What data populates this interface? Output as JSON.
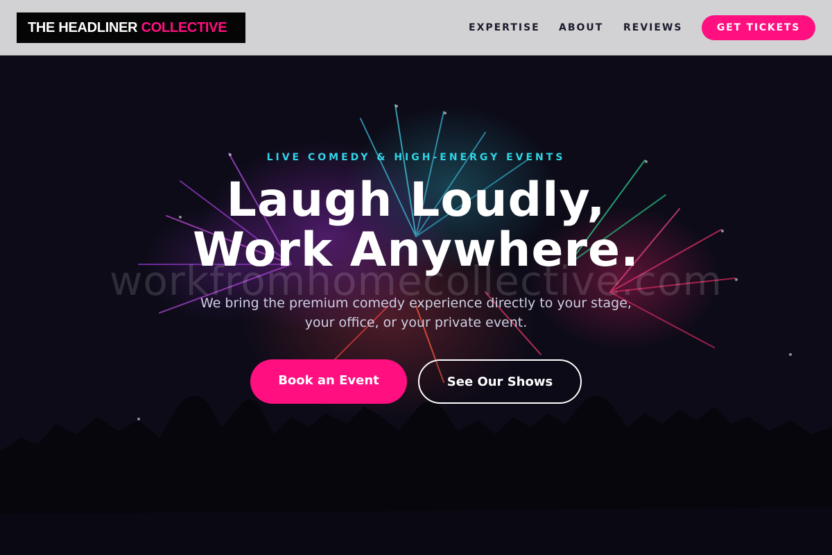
{
  "header": {
    "logo_main": "THE HEADLINER",
    "logo_accent": "COLLECTIVE",
    "nav": [
      "EXPERTISE",
      "ABOUT",
      "REVIEWS"
    ],
    "cta_label": "GET TICKETS"
  },
  "hero": {
    "eyebrow": "LIVE COMEDY & HIGH-ENERGY EVENTS",
    "headline_line1": "Laugh Loudly,",
    "headline_line2": "Work Anywhere.",
    "watermark": "workfromhomecollective.com",
    "subtext_line1": "We bring the premium comedy experience directly to your stage,",
    "subtext_line2": "your office, or your private event.",
    "primary_button": "Book an Event",
    "secondary_button": "See Our Shows",
    "background_image": "fireworks-crowd-silhouette"
  },
  "colors": {
    "accent": "#ff0f80",
    "eyebrow": "#2fd6e6",
    "nav_bg": "#d2d2d4",
    "hero_bg": "#0c0b17"
  }
}
